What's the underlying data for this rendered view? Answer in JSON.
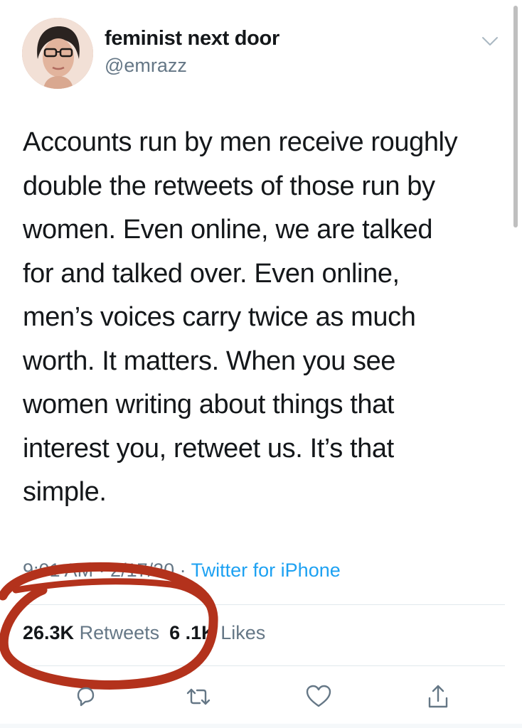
{
  "user": {
    "display_name": "feminist next door",
    "handle": "@emrazz"
  },
  "tweet": {
    "lines": [
      "Accounts run by men receive roughly",
      "double the retweets of those run by",
      "women. Even online, we are talked",
      "for and talked over. Even online,",
      "men’s voices carry twice as much",
      "worth. It matters. When you see",
      "women writing about things that",
      "interest you, retweet us. It’s that",
      "simple."
    ],
    "timestamp": "9:01 AM · 2/17/20",
    "separator": " · ",
    "source": "Twitter for iPhone"
  },
  "stats": {
    "retweets_count": "26.3K",
    "retweets_label": "Retweets",
    "likes_count": "6 .1K",
    "likes_label": "Likes"
  },
  "icons": {
    "caret": "chevron-down-icon",
    "reply": "reply-icon",
    "retweet": "retweet-icon",
    "like": "heart-icon",
    "share": "share-icon"
  },
  "colors": {
    "text": "#14171a",
    "secondary": "#657786",
    "link": "#1da1f2",
    "annotation_circle": "#b3321c"
  }
}
